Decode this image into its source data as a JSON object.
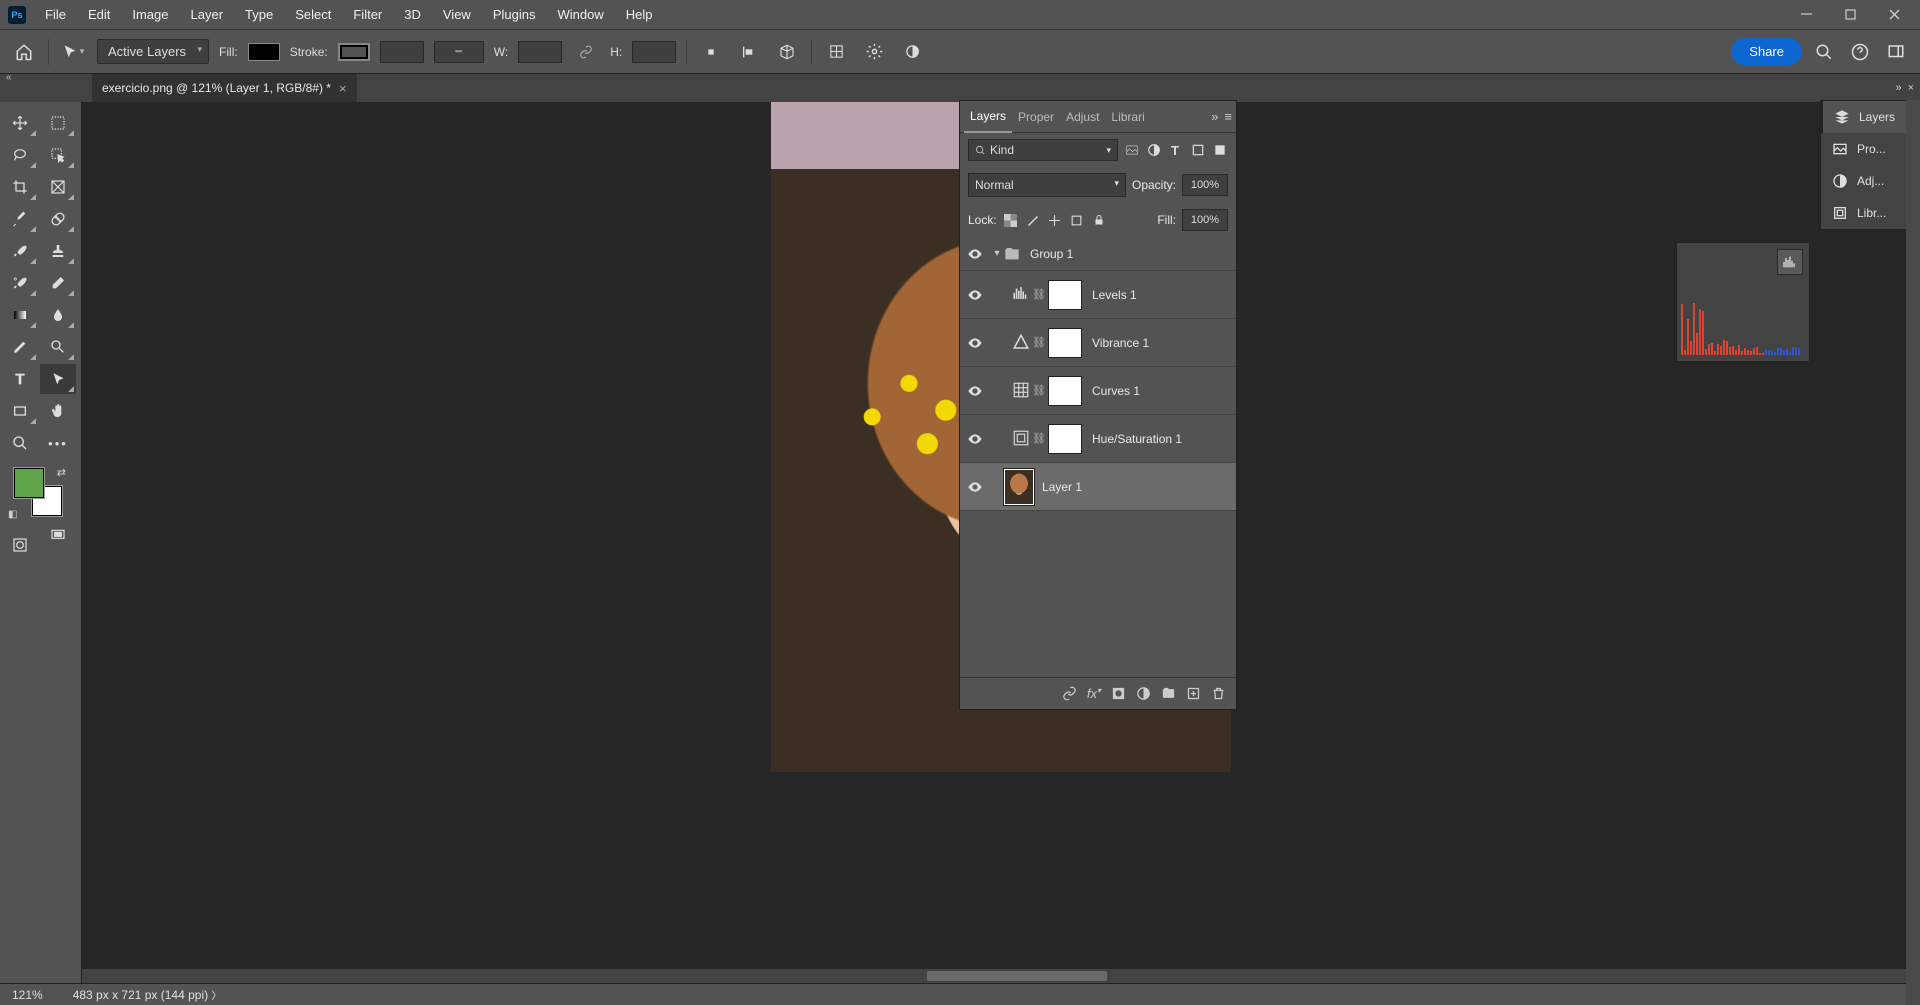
{
  "menu": [
    "File",
    "Edit",
    "Image",
    "Layer",
    "Type",
    "Select",
    "Filter",
    "3D",
    "View",
    "Plugins",
    "Window",
    "Help"
  ],
  "document_tab": "exercicio.png @ 121% (Layer 1, RGB/8#) *",
  "options": {
    "layer_select": "Active Layers",
    "fill_label": "Fill:",
    "stroke_label": "Stroke:",
    "w_label": "W:",
    "h_label": "H:",
    "share": "Share"
  },
  "layers_panel": {
    "tabs": [
      "Layers",
      "Proper",
      "Adjust",
      "Librari"
    ],
    "filter_kind": "Kind",
    "blend_mode": "Normal",
    "opacity_label": "Opacity:",
    "opacity_value": "100%",
    "lock_label": "Lock:",
    "fill_label": "Fill:",
    "fill_value": "100%",
    "layers": [
      {
        "type": "group",
        "name": "Group 1"
      },
      {
        "type": "adj",
        "icon": "levels",
        "name": "Levels 1"
      },
      {
        "type": "adj",
        "icon": "vibrance",
        "name": "Vibrance 1"
      },
      {
        "type": "adj",
        "icon": "curves",
        "name": "Curves 1"
      },
      {
        "type": "adj",
        "icon": "huesat",
        "name": "Hue/Saturation 1"
      },
      {
        "type": "image",
        "name": "Layer 1",
        "selected": true
      }
    ]
  },
  "dock": [
    "Layers",
    "Pro...",
    "Adj...",
    "Libr..."
  ],
  "status": {
    "zoom": "121%",
    "info": "483 px x 721 px (144 ppi)"
  },
  "colors": {
    "fg": "#5fa44b",
    "bg": "#ffffff",
    "accent": "#0d66d0"
  }
}
